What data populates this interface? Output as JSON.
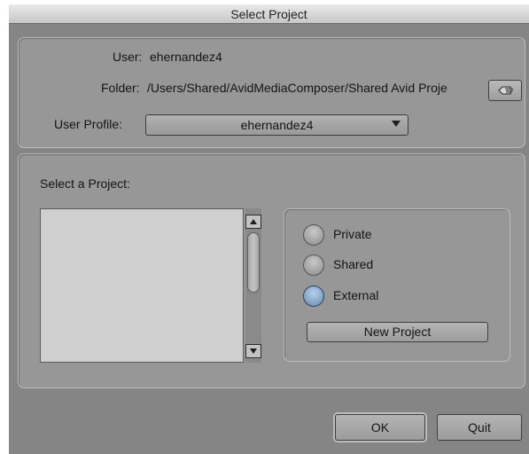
{
  "window": {
    "title": "Select Project"
  },
  "info": {
    "user_label": "User:",
    "user_value": "ehernandez4",
    "folder_label": "Folder:",
    "folder_value": "/Users/Shared/AvidMediaComposer/Shared Avid Proje",
    "folder_button_icon": "pointing-hand-icon",
    "profile_label": "User Profile:",
    "profile_value": "ehernandez4"
  },
  "projects": {
    "heading": "Select a Project:",
    "items": []
  },
  "location": {
    "options": [
      {
        "label": "Private",
        "selected": false
      },
      {
        "label": "Shared",
        "selected": false
      },
      {
        "label": "External",
        "selected": true
      }
    ],
    "new_project_label": "New Project"
  },
  "footer": {
    "ok_label": "OK",
    "quit_label": "Quit"
  },
  "colors": {
    "background": "#858585",
    "panel": "#979797",
    "selected_radio": "#6686ad"
  }
}
